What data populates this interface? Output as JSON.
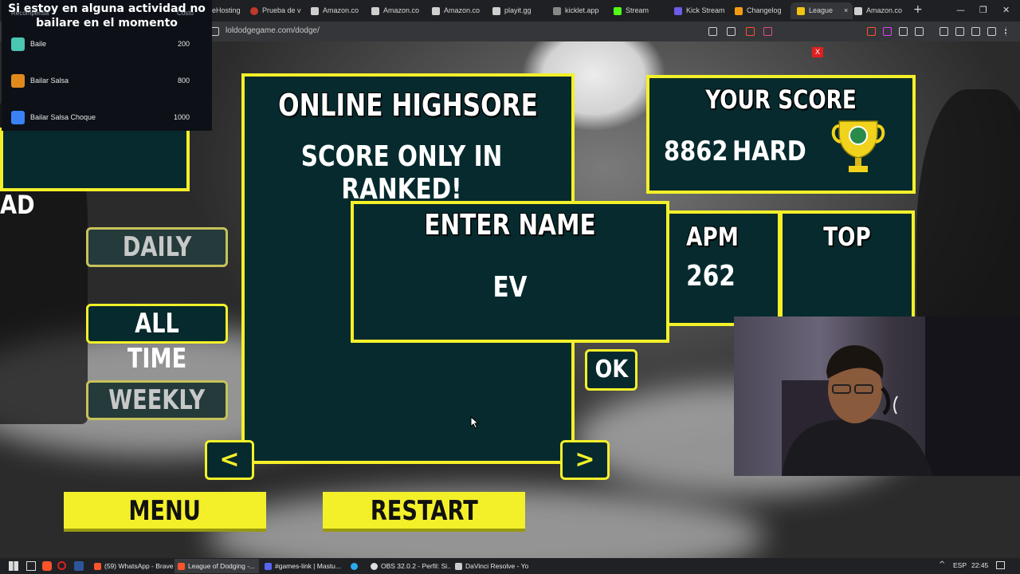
{
  "browser": {
    "tabs": [
      {
        "label": "eHosting",
        "color": "#8ab4f8"
      },
      {
        "label": "Prueba de v",
        "color": "#c0392b"
      },
      {
        "label": "Amazon.co",
        "color": "#e6e6e6"
      },
      {
        "label": "Amazon.co",
        "color": "#e6e6e6"
      },
      {
        "label": "Amazon.co",
        "color": "#e6e6e6"
      },
      {
        "label": "playit.gg",
        "color": "#e6e6e6"
      },
      {
        "label": "kicklet.app",
        "color": "#bdbdbd"
      },
      {
        "label": "Stream",
        "color": "#53fc18"
      },
      {
        "label": "Kick Stream",
        "color": "#6c5ce7"
      },
      {
        "label": "Changelog",
        "color": "#f39c12"
      },
      {
        "label": "League",
        "color": "#f1c40f"
      },
      {
        "label": "Amazon.co",
        "color": "#e6e6e6"
      }
    ],
    "active_tab_index": 10,
    "new_tab": "+",
    "url": "loldodgegame.com/dodge/"
  },
  "overlay": {
    "title": "Si estoy en alguna actividad no bailare en el momento",
    "header_left": "Recompensa",
    "header_right": "Costo",
    "rewards": [
      {
        "name": "Baile",
        "cost": "200",
        "color": "#49c7b0"
      },
      {
        "name": "Bailar Salsa",
        "cost": "800",
        "color": "#e08a1e"
      },
      {
        "name": "Bailar Salsa Choque",
        "cost": "1000",
        "color": "#3b82f6"
      }
    ]
  },
  "game": {
    "close_label": "X",
    "leaderboard_title": "ONLINE HIGHSORE",
    "leaderboard_notice": "SCORE ONLY IN RANKED!",
    "partial_text": "AD",
    "tabs": [
      "DAILY",
      "ALL TIME",
      "WEEKLY"
    ],
    "selected_tab": "ALL TIME",
    "prev_arrow": "<",
    "next_arrow": ">",
    "menu_label": "MENU",
    "restart_label": "RESTART",
    "your_score_title": "YOUR SCORE",
    "score_value": "8862",
    "difficulty": "HARD",
    "apm_label": "APM",
    "apm_value": "262",
    "top_label": "TOP",
    "enter_name_title": "ENTER NAME",
    "name_value": "EV",
    "ok_label": "OK"
  },
  "taskbar": {
    "items": [
      {
        "label": "(59) WhatsApp - Brave",
        "color": "#fb542b"
      },
      {
        "label": "League of Dodging -...",
        "color": "#fb542b"
      },
      {
        "label": "#games-link | Mastu...",
        "color": "#5865f2"
      },
      {
        "label": "",
        "color": "#2aabee"
      },
      {
        "label": "OBS 32.0.2 - Perfil: Si...",
        "color": "#dddddd"
      },
      {
        "label": "DaVinci Resolve - Yo",
        "color": "#cccccc"
      }
    ],
    "language": "ESP",
    "time": "22:45"
  }
}
